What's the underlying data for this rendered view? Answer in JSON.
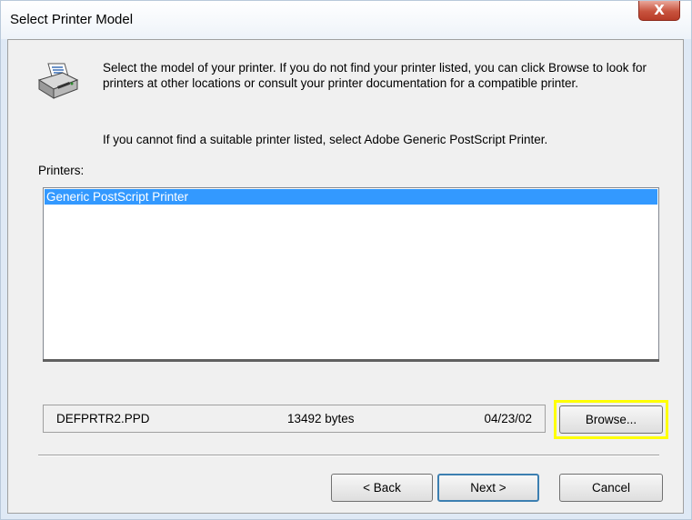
{
  "window": {
    "title": "Select Printer Model",
    "close_glyph": "X"
  },
  "icons": {
    "printer": "printer-icon",
    "close": "close-icon"
  },
  "instructions": {
    "intro": "Select the model of your printer. If you do not find your printer listed, you can click Browse to look for printers at other locations or consult your printer documentation for a compatible printer.",
    "fallback": "If you cannot find a suitable printer listed, select Adobe Generic PostScript Printer."
  },
  "printers": {
    "label": "Printers:",
    "items": [
      "Generic PostScript Printer"
    ],
    "selected_index": 0
  },
  "file_info": {
    "name": "DEFPRTR2.PPD",
    "size": "13492 bytes",
    "date": "04/23/02"
  },
  "buttons": {
    "browse": "Browse...",
    "back": "< Back",
    "next": "Next >",
    "cancel": "Cancel"
  },
  "colors": {
    "selection": "#3399ff",
    "highlight_box": "#ffff00",
    "close_button": "#c8533e"
  }
}
